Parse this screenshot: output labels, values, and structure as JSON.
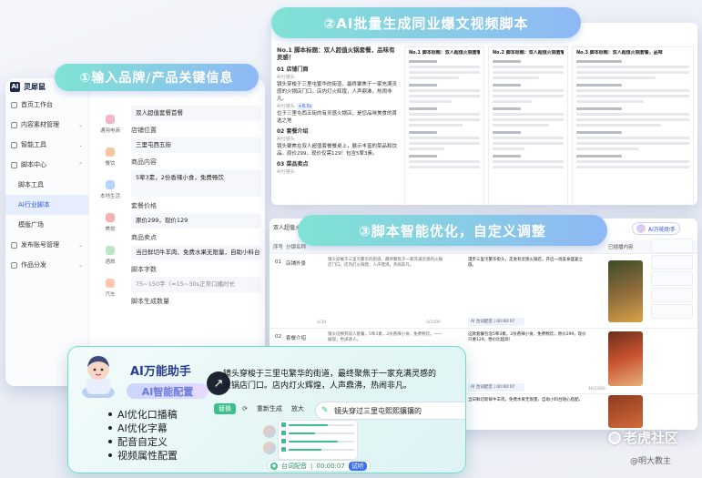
{
  "labels": {
    "step1": "①输入品牌/产品关键信息",
    "step2": "②AI批量生成同业爆文视频脚本",
    "step3": "③脚本智能优化，自定义调整"
  },
  "app": {
    "logo": "灵犀鼠"
  },
  "sidebar": {
    "items": [
      {
        "label": "首页工作台"
      },
      {
        "label": "内容素材管理"
      },
      {
        "label": "智能工具"
      },
      {
        "label": "脚本中心"
      },
      {
        "label": "脚本工具"
      },
      {
        "label": "AI行业脚本"
      },
      {
        "label": "模版广场"
      },
      {
        "label": "发布账号管理"
      },
      {
        "label": "作品分发"
      }
    ]
  },
  "tools": [
    {
      "label": "通用电商",
      "color": "#f5b5c8"
    },
    {
      "label": "餐饮",
      "color": "#f7c7a0"
    },
    {
      "label": "本地生活",
      "color": "#b5d4f7"
    },
    {
      "label": "美妆",
      "color": "#f9b0b0"
    },
    {
      "label": "酒旅",
      "color": "#bde6c9"
    },
    {
      "label": "汽车",
      "color": "#ffc7b0"
    }
  ],
  "form": {
    "brand_value": "双人超值套餐首餐",
    "store_label": "店铺位置",
    "store_value": "三里屯西五街",
    "content_label": "商品内容",
    "content_value": "5荤3素，2份香辣小食，免费畅饮",
    "price_label": "套餐价格",
    "price_value": "原价299，现价129",
    "selling_label": "商品卖点",
    "selling_value": "当日鲜切牛羊肉、免费水果无限量，自助小料台",
    "words_label": "脚本字数",
    "words_hint": "75~150字（≈15~30s正常口播时长",
    "count_label": "脚本生成数量"
  },
  "doc": {
    "title": "No.1 脚本标题：双人超值火锅套餐，品味有灵感！",
    "s1_head": "01 店铺门面",
    "s1_sub": "AI分镜头",
    "s1_tag": "+8.5s",
    "s1_text1": "镜头穿梭于三里屯繁华的街道，最终聚焦于一家充满灵感的火锅店门口。店内灯火辉煌，人声鼎沸，热闹非凡。",
    "s1_text2": "位于三里屯西五街的有灵感火锅店，是您品味美食的首选之地",
    "s2_head": "02 套餐介绍",
    "s2_sub": "AI分镜头",
    "s2_text": "镜头聚焦在双人超值套餐餐桌上，展示丰富的菜品和饮品。原价299，现价仅需129！包含5荤3素。",
    "s3_head": "03 菜品卖点",
    "s3_sub": "AI分镜头",
    "col1_title": "No.1 脚本标题：双人超值火锅套餐，品味",
    "col2_title": "No.2 脚本标题：双人超值火锅套餐，品味",
    "col3_title": "No.3 脚本标题：双人超值火锅套餐，品味"
  },
  "table": {
    "title": "双人超值火锅",
    "h_no": "序号",
    "h_name": "分镜名称",
    "h_side": "已插播内容",
    "assist_label": "AI万能助手",
    "row1": {
      "no": "01",
      "name": "店铺外景",
      "orig": "镜头穿梭于三里屯繁华的街道，最终聚焦于一家充满灵感的火锅店门口。店内灯火辉煌，人声鼎沸，热闹非凡。",
      "opt": "漫步三里屯繁华街头，走进有灵感火锅店，开启一场美食盛宴之旅。",
      "count_l": "4/30",
      "count_r": "0/1000",
      "mini": "AI 台词配音 | 00:00:07"
    },
    "row2": {
      "no": "02",
      "name": "套餐介绍",
      "orig": "镜头切换到双人套餐，5荤3素，2份香辣小食，免费畅饮。一一展现，色泽诱人。",
      "opt": "这款套餐包含5荤3素，2份香辣小食，免费畅饮，原价299，现价只要129，性价比超高！",
      "mini": "AI 台词配音 | 00:00:07"
    },
    "row3": {
      "opt": "当日鲜切新鲜牛羊肉，免费水果无限量，自助小料台随心搭配。",
      "count_r": "46/1000"
    }
  },
  "assistant": {
    "title": "AI万能助手",
    "subtitle": "AI智能配置",
    "quote": "镜头穿梭于三里屯繁华的街道，最终聚焦于一家充满灵感的火锅店门口。店内灯火辉煌，人声鼎沸，热闹非凡。",
    "btn_replace": "替换",
    "btn_regen": "重新生成",
    "btn_zoom": "放大",
    "search_text": "镜头穿过三里屯熙熙攘攘的",
    "features": [
      "AI优化口播稿",
      "AI优化字幕",
      "配音自定义",
      "视频属性配置"
    ],
    "dub_label": "台词配音",
    "dub_time": "00:00:07",
    "dub_try": "试听"
  },
  "watermark": {
    "text": "老虎社区",
    "credit": "@明大教主"
  }
}
